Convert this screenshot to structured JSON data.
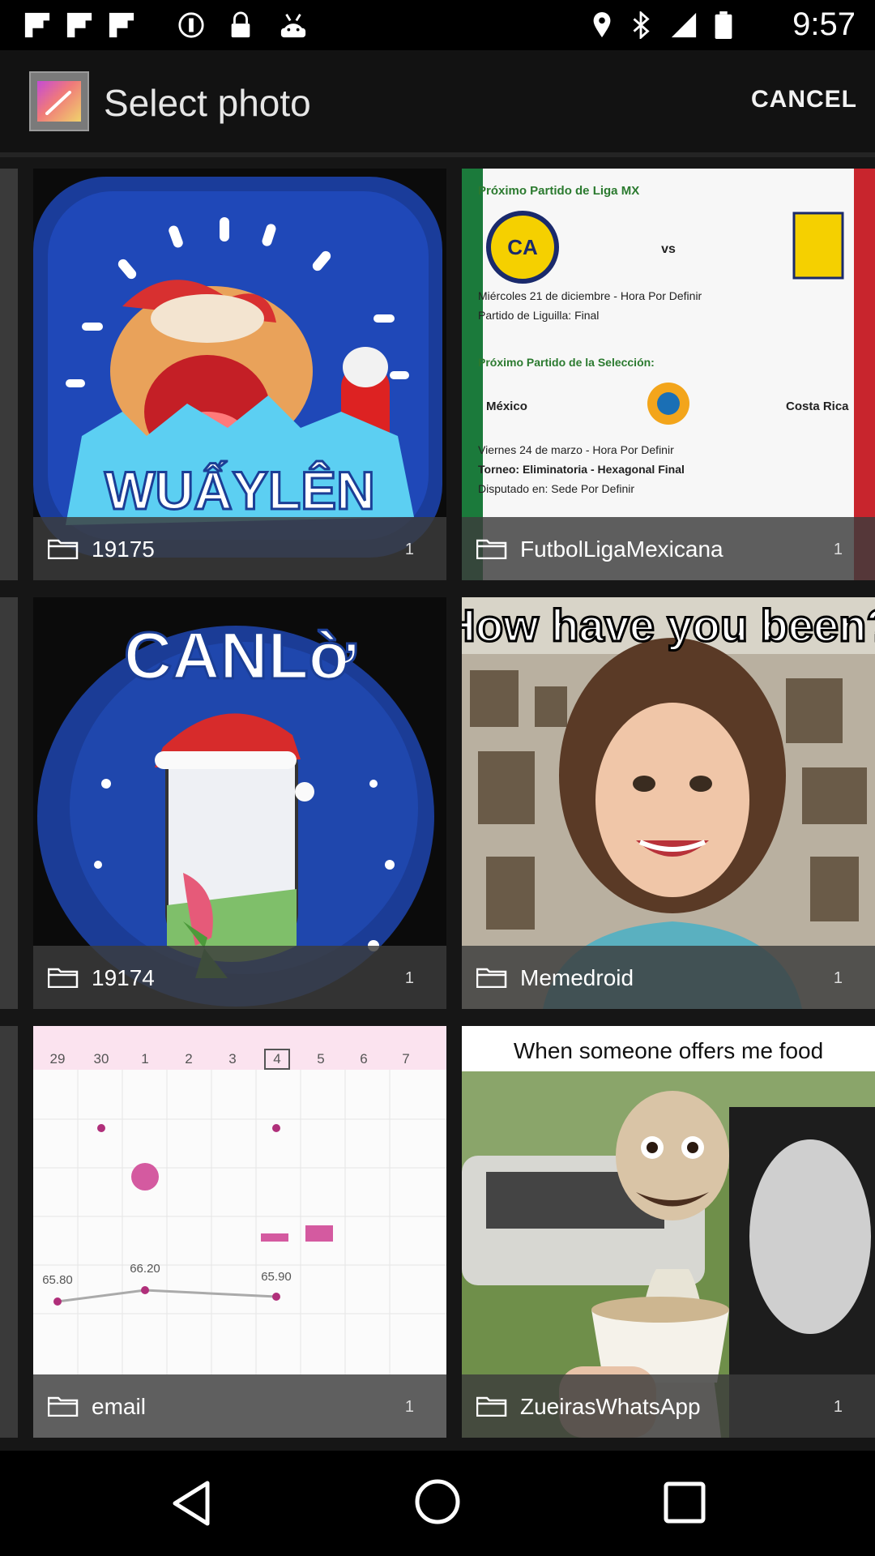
{
  "status_bar": {
    "time": "9:57",
    "icons": [
      "flipboard-icon",
      "flipboard-icon",
      "flipboard-icon",
      "silent-icon",
      "lock-icon",
      "android-icon",
      "location-icon",
      "bluetooth-icon",
      "signal-icon",
      "battery-icon"
    ]
  },
  "header": {
    "title": "Select photo",
    "cancel_label": "CANCEL"
  },
  "albums": [
    {
      "name": "19175",
      "count": "1",
      "thumb_text": "WUẤYLÊN"
    },
    {
      "name": "FutbolLigaMexicana",
      "count": "1",
      "thumb_lines": [
        "Próximo Partido de Liga MX",
        "vs",
        "Miércoles 21 de diciembre - Hora Por Definir",
        "Partido de Liguilla: Final",
        "Próximo Partido de la Selección:",
        "México",
        "Costa Rica",
        "Viernes 24 de marzo - Hora Por Definir",
        "Torneo: Eliminatoria - Hexagonal Final",
        "Disputado en: Sede Por Definir"
      ]
    },
    {
      "name": "19174",
      "count": "1",
      "thumb_text": "CANLờ"
    },
    {
      "name": "Memedroid",
      "count": "1",
      "thumb_text": "How have you been?"
    },
    {
      "name": "email",
      "count": "1",
      "thumb_days": [
        "29",
        "30",
        "1",
        "2",
        "3",
        "4",
        "5",
        "6",
        "7"
      ],
      "thumb_values": [
        "65.80",
        "66.20",
        "65.90"
      ]
    },
    {
      "name": "ZueirasWhatsApp",
      "count": "1",
      "thumb_text": "When someone offers me food"
    }
  ],
  "nav": [
    "back-icon",
    "home-icon",
    "recents-icon"
  ]
}
